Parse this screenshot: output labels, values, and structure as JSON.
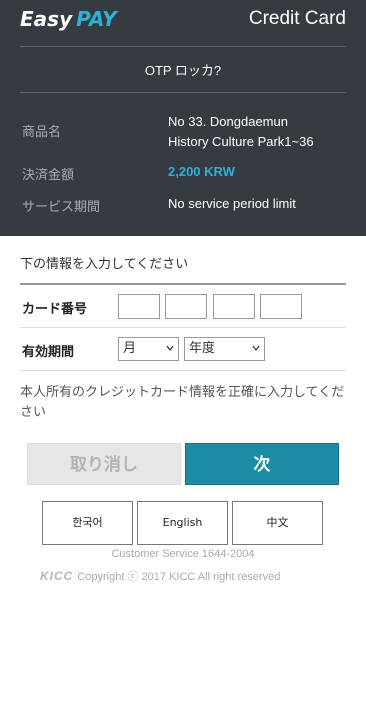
{
  "header": {
    "brand_easy": "Easy",
    "brand_pay": "PAY",
    "title": "Credit Card",
    "otp_link": "OTP ロッカ?"
  },
  "order_info": {
    "product_label": "商品名",
    "product_line1": "No 33. Dongdaemun",
    "product_line2": "History Culture Park1~36",
    "amount_label": "決済金額",
    "amount_value": "2,200 KRW",
    "service_label": "サービス期間",
    "service_value": "No service period limit"
  },
  "form": {
    "instruction": "下の情報を入力してください",
    "card_number_label": "カード番号",
    "expiry_label": "有効期間",
    "month_selected": "月",
    "year_selected": "年度",
    "notice": "本人所有のクレジットカード情報を正確に入力してください"
  },
  "buttons": {
    "cancel": "取り消し",
    "next": "次"
  },
  "languages": [
    "한국어",
    "English",
    "中文"
  ],
  "footer": {
    "service": "Customer Service 1644-2004",
    "logo": "KICC",
    "copyright": "Copyright ⓒ 2017 KICC All right reserved"
  },
  "colors": {
    "header_bg": "#363b42",
    "accent": "#2fb0d6",
    "next_button": "#1b8ca3"
  }
}
